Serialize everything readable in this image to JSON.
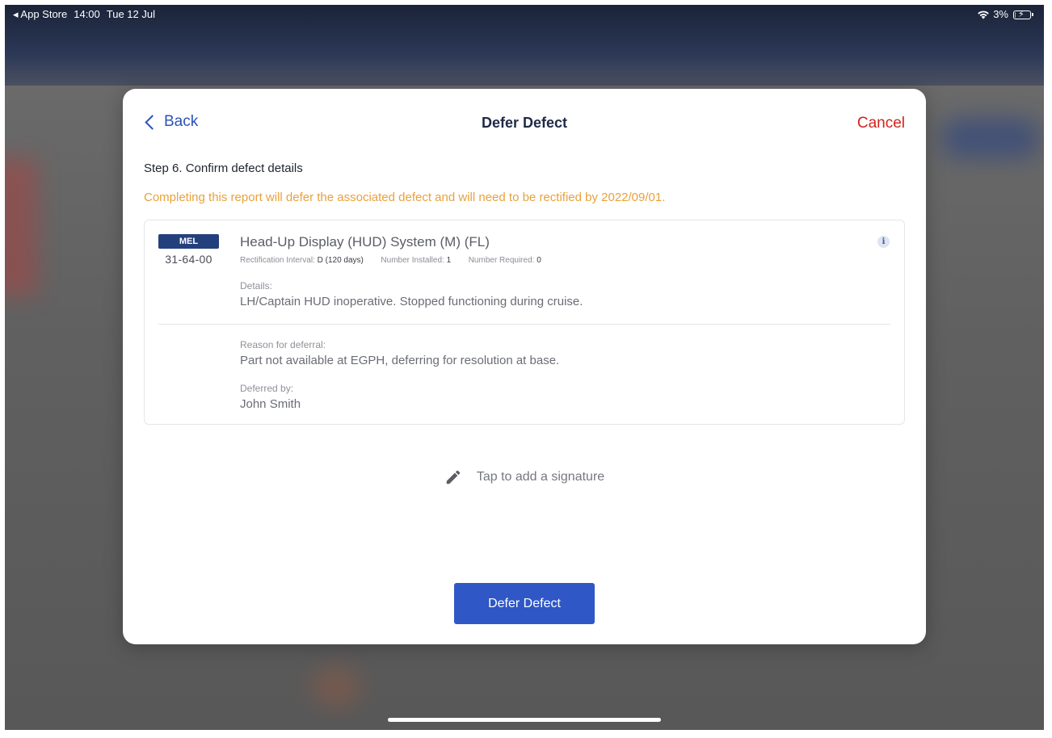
{
  "status_bar": {
    "back_app": "◂ App Store",
    "time": "14:00",
    "date": "Tue 12 Jul",
    "battery_percent": "3%",
    "battery_level": 0.03
  },
  "modal": {
    "back_label": "Back",
    "title": "Defer Defect",
    "cancel_label": "Cancel",
    "step_title": "Step 6. Confirm defect details",
    "warning": "Completing this report will defer the associated defect and will need to be rectified by 2022/09/01."
  },
  "defect": {
    "badge": "MEL",
    "ata_code": "31-64-00",
    "title": "Head-Up Display (HUD) System (M) (FL)",
    "rectification_interval_label": "Rectification Interval:",
    "rectification_interval_value": "D (120 days)",
    "number_installed_label": "Number Installed:",
    "number_installed_value": "1",
    "number_required_label": "Number Required:",
    "number_required_value": "0",
    "details_label": "Details:",
    "details_value": "LH/Captain HUD inoperative. Stopped functioning during cruise.",
    "reason_label": "Reason for deferral:",
    "reason_value": "Part not available at EGPH, deferring for resolution at base.",
    "deferred_by_label": "Deferred by:",
    "deferred_by_value": "John Smith"
  },
  "signature": {
    "prompt": "Tap to add a signature"
  },
  "actions": {
    "defer_label": "Defer Defect"
  },
  "colors": {
    "accent_blue": "#2f57c5",
    "badge_navy": "#24407c",
    "cancel_red": "#d0241c",
    "warning_orange": "#e9a13c"
  }
}
